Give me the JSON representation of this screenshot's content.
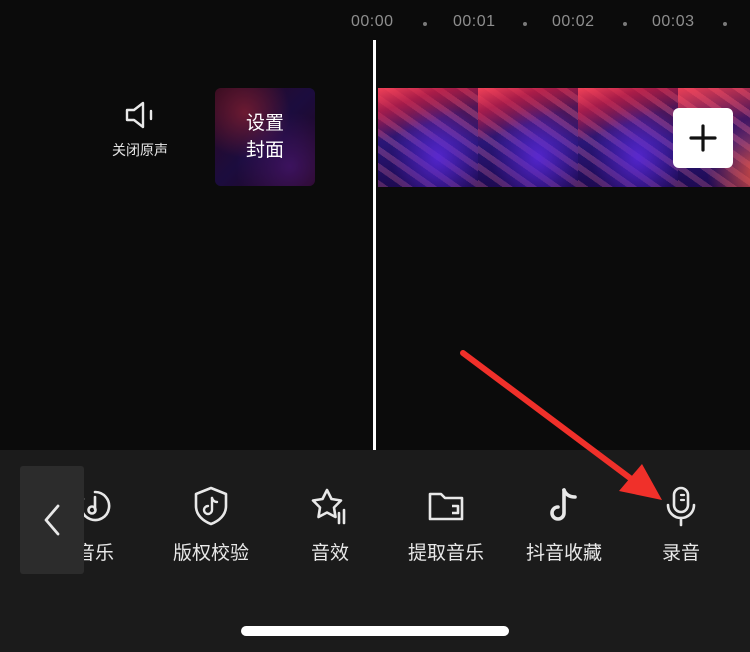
{
  "timeline": {
    "ticks": [
      "00:00",
      "00:01",
      "00:02",
      "00:03"
    ]
  },
  "mute_button": {
    "label": "关闭原声"
  },
  "cover_button": {
    "line1": "设置",
    "line2": "封面"
  },
  "toolbar": {
    "tools": [
      {
        "label": "音乐",
        "icon": "music-disc-icon"
      },
      {
        "label": "版权校验",
        "icon": "shield-tiktok-icon"
      },
      {
        "label": "音效",
        "icon": "star-sound-icon"
      },
      {
        "label": "提取音乐",
        "icon": "folder-icon"
      },
      {
        "label": "抖音收藏",
        "icon": "tiktok-icon"
      },
      {
        "label": "录音",
        "icon": "microphone-icon"
      }
    ]
  },
  "colors": {
    "background": "#0b0b0b",
    "toolbar_bg": "#1b1b1b",
    "annotation_arrow": "#f0302a"
  }
}
